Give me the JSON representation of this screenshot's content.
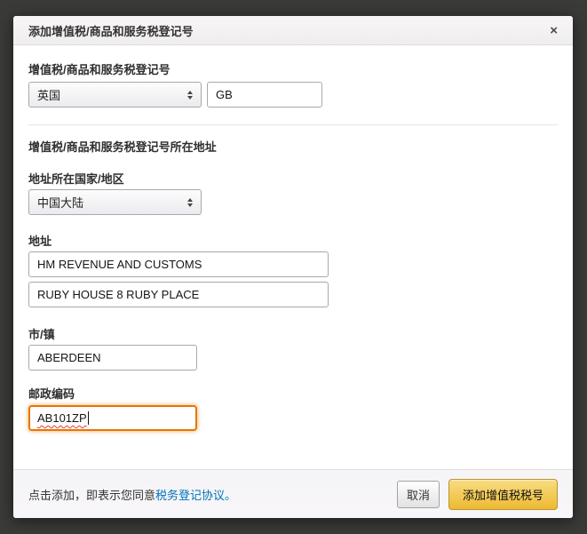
{
  "dialog": {
    "title": "添加增值税/商品和服务税登记号",
    "close_glyph": "×",
    "vat_section": {
      "label": "增值税/商品和服务税登记号",
      "country_value": "英国",
      "number_value": "GB"
    },
    "address_section": {
      "heading": "增值税/商品和服务税登记号所在地址",
      "country_label": "地址所在国家/地区",
      "country_value": "中国大陆",
      "address_label": "地址",
      "address_line1": "HM REVENUE AND CUSTOMS",
      "address_line2": "RUBY HOUSE 8 RUBY PLACE",
      "city_label": "市/镇",
      "city_value": "ABERDEEN",
      "postal_label": "邮政编码",
      "postal_value": "AB101ZP"
    },
    "footer": {
      "agreement_prefix": "点击添加，即表示您同意",
      "agreement_link": "税务登记协议。",
      "cancel_label": "取消",
      "submit_label": "添加增值税税号"
    },
    "colors": {
      "backdrop": "#3a3b38",
      "focus_accent_orange": "#e77600",
      "link_blue": "#0073bb",
      "spellcheck_red": "#e03c31",
      "submit_gradient_top": "#f8dd82",
      "submit_gradient_bottom": "#edb933",
      "submit_border": "#b9952e"
    }
  }
}
